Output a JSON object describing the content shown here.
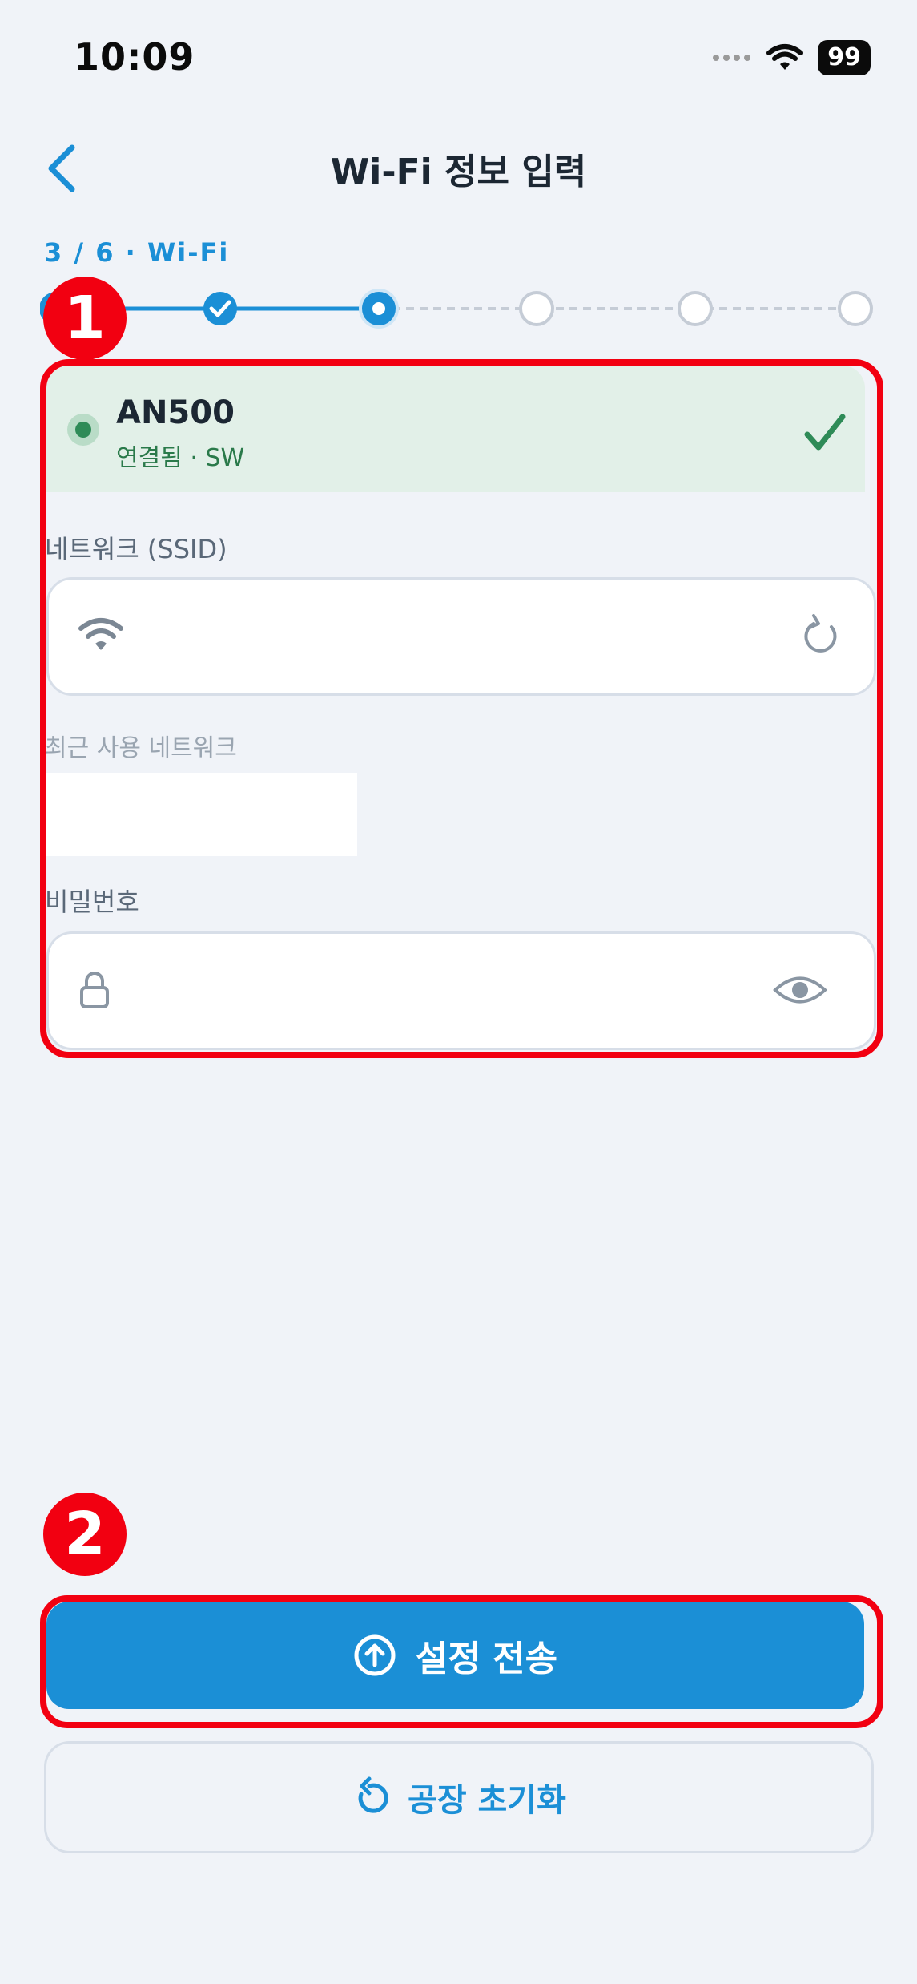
{
  "status_bar": {
    "time": "10:09",
    "battery": "99"
  },
  "header": {
    "title": "Wi-Fi 정보 입력"
  },
  "stepper": {
    "label": "3 / 6 · Wi-Fi",
    "current": 3,
    "total": 6
  },
  "annotations": {
    "first": "1",
    "second": "2"
  },
  "connection": {
    "name": "AN500",
    "status": "연결됨 · SW"
  },
  "form": {
    "ssid_label": "네트워크 (SSID)",
    "ssid_value": "",
    "recent_label": "최근 사용 네트워크",
    "password_label": "비밀번호",
    "password_value": ""
  },
  "buttons": {
    "send": "설정 전송",
    "factory_reset": "공장 초기화"
  },
  "colors": {
    "accent": "#1b8fd6",
    "success": "#2e8b57",
    "annotation": "#f20011",
    "background": "#f0f3f8"
  }
}
